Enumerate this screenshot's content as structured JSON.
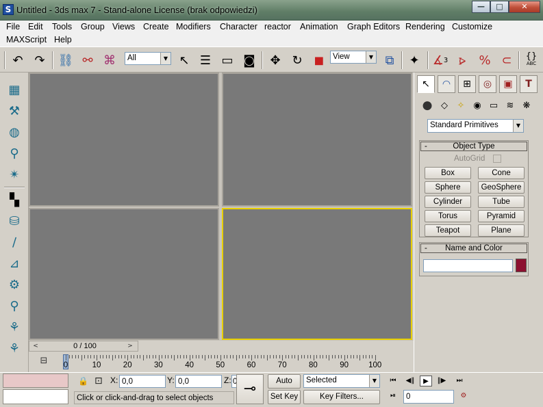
{
  "window": {
    "title": "Untitled - 3ds max 7  - Stand-alone License (brak odpowiedzi)",
    "app_icon": "3ds-max-logo-icon",
    "app_icon_letter": "S",
    "controls": {
      "minimize": "—",
      "maximize": "□",
      "close": "✕"
    }
  },
  "menu": [
    "File",
    "Edit",
    "Tools",
    "Group",
    "Views",
    "Create",
    "Modifiers",
    "Character",
    "reactor",
    "Animation",
    "Graph Editors",
    "Rendering",
    "Customize",
    "MAXScript",
    "Help"
  ],
  "toolbar": {
    "selection_filter": "All",
    "reference_coord": "View",
    "icons": {
      "undo": "↶",
      "redo": "↷",
      "link": "⛓",
      "unlink": "⚯",
      "bind": "⌘",
      "select": "↖",
      "select_by_name": "☰",
      "rect_region": "▭",
      "window_crossing": "◙",
      "move": "✥",
      "rotate": "↻",
      "scale": "◼",
      "pivot": "⧉",
      "manipulate": "✦",
      "snaps": "∡",
      "angle_snap": "⦠",
      "percent_snap": "%",
      "spinner_snap": "⊂",
      "named_selections": "{}"
    },
    "snap_label_3": "3",
    "abc_label": "ABC"
  },
  "left_tools": [
    "▦",
    "⚒",
    "◍",
    "⚲",
    "✴",
    "▚",
    "⛁",
    "∕",
    "⊿",
    "⚙",
    "⚲",
    "⚘",
    "⚘"
  ],
  "command_panel": {
    "tabs": [
      "↖",
      "◠",
      "⊞",
      "◎",
      "▣",
      "T"
    ],
    "subicons": [
      "●",
      "◇",
      "✧",
      "◉",
      "▭",
      "≋",
      "❋"
    ],
    "category": "Standard Primitives",
    "object_type": {
      "header": "Object Type",
      "minus": "-",
      "autogrid": "AutoGrid",
      "buttons": [
        "Box",
        "Cone",
        "Sphere",
        "GeoSphere",
        "Cylinder",
        "Tube",
        "Torus",
        "Pyramid",
        "Teapot",
        "Plane"
      ]
    },
    "name_color": {
      "header": "Name and Color",
      "minus": "-",
      "name_value": "",
      "swatch_color": "#8c1030"
    }
  },
  "timeline": {
    "frames": "0 / 100",
    "left_arrow": "<",
    "right_arrow": ">",
    "ticks": [
      "0",
      "10",
      "20",
      "30",
      "40",
      "50",
      "60",
      "70",
      "80",
      "90",
      "100"
    ],
    "track_button": "⊟"
  },
  "status": {
    "lock_icon": "🔒",
    "abs_icon": "⊡",
    "x_label": "X:",
    "x_value": "0,0",
    "y_label": "Y:",
    "y_value": "0,0",
    "z_label": "Z:",
    "z_value": "0",
    "prompt": "Click or click-and-drag to select objects",
    "key_icon": "⊸",
    "auto_key": "Auto Key",
    "set_key": "Set Key",
    "key_mode": "Selected",
    "key_filters": "Key Filters...",
    "frame_value": "0",
    "play": {
      "start": "⏮",
      "prev": "◀‖",
      "play": "▶",
      "next": "‖▶",
      "end": "⏭",
      "keymode": "⏯",
      "timecfg": "⚙"
    }
  }
}
